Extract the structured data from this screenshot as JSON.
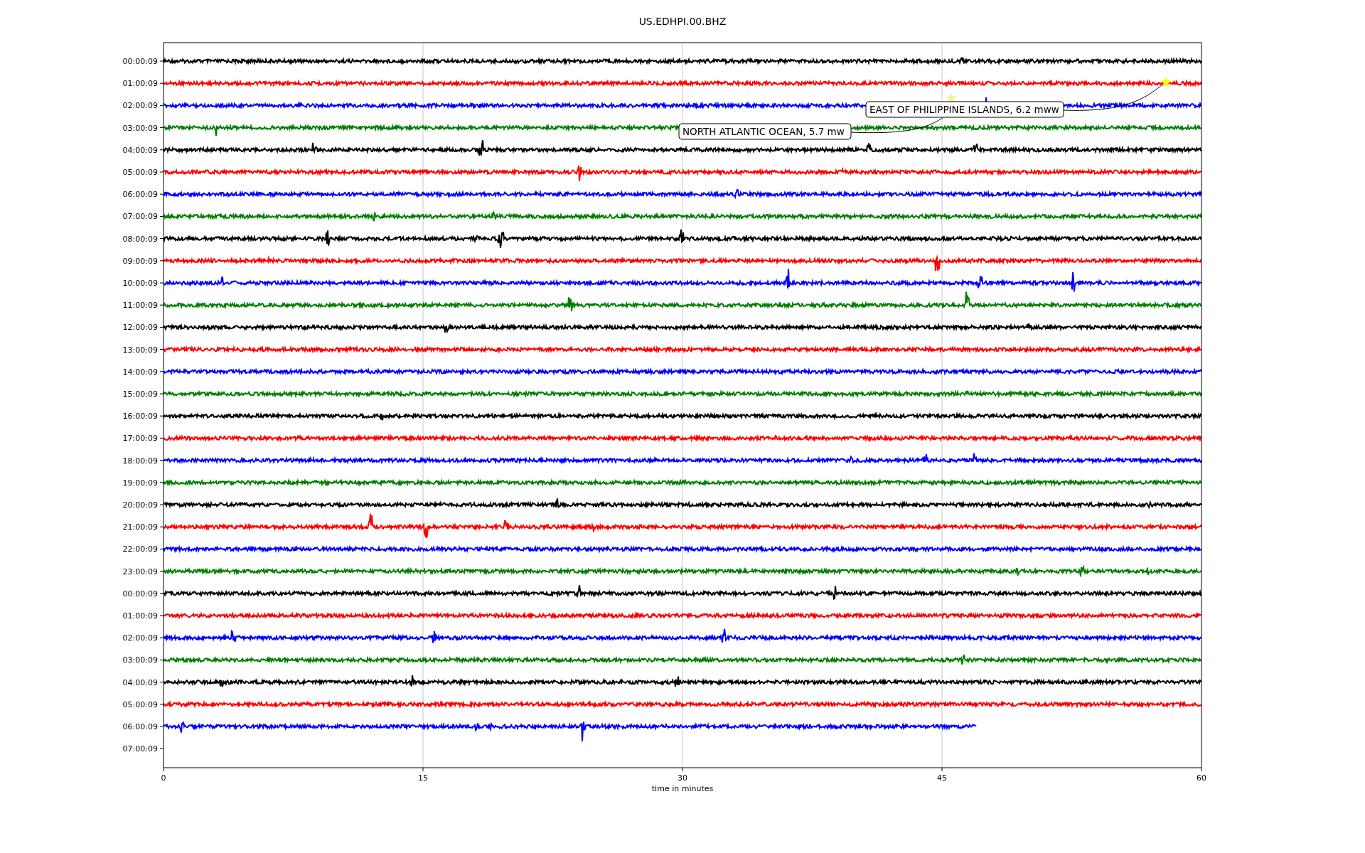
{
  "title": "US.EDHPI.00.BHZ",
  "x_axis": {
    "label": "time in minutes",
    "ticks": [
      "0",
      "15",
      "30",
      "45",
      "60"
    ]
  },
  "traces": [
    {
      "label": "00:00:09",
      "color": "#000000",
      "level": 1
    },
    {
      "label": "01:00:09",
      "color": "#ff0000",
      "level": 1
    },
    {
      "label": "02:00:09",
      "color": "#0000ff",
      "level": 1
    },
    {
      "label": "03:00:09",
      "color": "#008000",
      "level": 1
    },
    {
      "label": "04:00:09",
      "color": "#000000",
      "level": 1
    },
    {
      "label": "05:00:09",
      "color": "#ff0000",
      "level": 1
    },
    {
      "label": "06:00:09",
      "color": "#0000ff",
      "level": 1
    },
    {
      "label": "07:00:09",
      "color": "#008000",
      "level": 1
    },
    {
      "label": "08:00:09",
      "color": "#000000",
      "level": 1
    },
    {
      "label": "09:00:09",
      "color": "#ff0000",
      "level": 1
    },
    {
      "label": "10:00:09",
      "color": "#0000ff",
      "level": 1
    },
    {
      "label": "11:00:09",
      "color": "#008000",
      "level": 1
    },
    {
      "label": "12:00:09",
      "color": "#000000",
      "level": 1
    },
    {
      "label": "13:00:09",
      "color": "#ff0000",
      "level": 1
    },
    {
      "label": "14:00:09",
      "color": "#0000ff",
      "level": 1
    },
    {
      "label": "15:00:09",
      "color": "#008000",
      "level": 1
    },
    {
      "label": "16:00:09",
      "color": "#000000",
      "level": 1
    },
    {
      "label": "17:00:09",
      "color": "#ff0000",
      "level": 1
    },
    {
      "label": "18:00:09",
      "color": "#0000ff",
      "level": 1
    },
    {
      "label": "19:00:09",
      "color": "#008000",
      "level": 1
    },
    {
      "label": "20:00:09",
      "color": "#000000",
      "level": 1
    },
    {
      "label": "21:00:09",
      "color": "#ff0000",
      "level": 1
    },
    {
      "label": "22:00:09",
      "color": "#0000ff",
      "level": 1
    },
    {
      "label": "23:00:09",
      "color": "#008000",
      "level": 1
    },
    {
      "label": "00:00:09",
      "color": "#000000",
      "level": 1
    },
    {
      "label": "01:00:09",
      "color": "#ff0000",
      "level": 1
    },
    {
      "label": "02:00:09",
      "color": "#0000ff",
      "level": 1
    },
    {
      "label": "03:00:09",
      "color": "#008000",
      "level": 1
    },
    {
      "label": "04:00:09",
      "color": "#000000",
      "level": 1
    },
    {
      "label": "05:00:09",
      "color": "#ff0000",
      "level": 1
    },
    {
      "label": "06:00:09",
      "color": "#0000ff",
      "level": 0.783
    },
    {
      "label": "07:00:09"
    }
  ],
  "annotations": [
    {
      "text": "EAST OF PHILIPPINE ISLANDS, 6.2 mww"
    },
    {
      "text": "NORTH ATLANTIC OCEAN, 5.7 mw"
    }
  ]
}
